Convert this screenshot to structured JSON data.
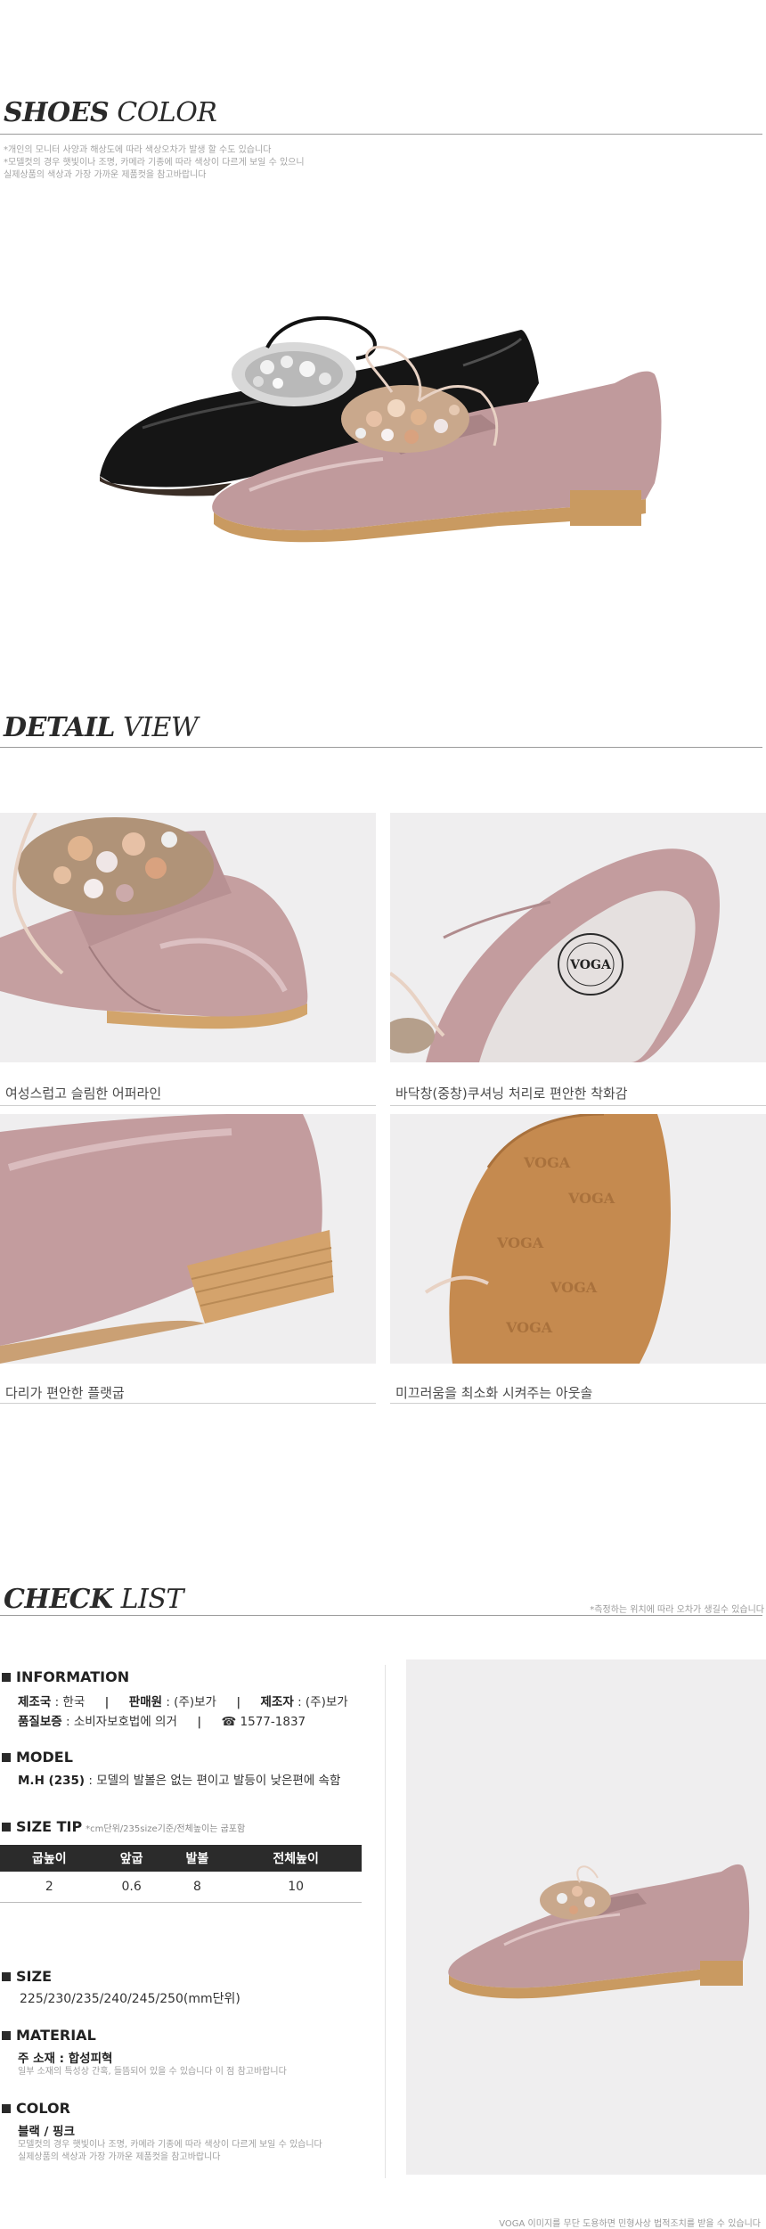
{
  "shoes_color": {
    "title_bold": "SHOES",
    "title_rest": "COLOR",
    "notes": [
      "*개인의 모니터 사양과 해상도에 따라 색상오차가 발생 할 수도 있습니다",
      "*모델컷의 경우 햇빛이나 조명, 카메라 기종에 따라 색상이 다르게 보일 수 있으니",
      "  실제상품의 색상과 가장 가까운 제품컷을 참고바랍니다"
    ]
  },
  "detail_view": {
    "title_bold": "DETAIL",
    "title_rest": "VIEW",
    "captions": [
      "여성스럽고 슬림한 어퍼라인",
      "바닥창(중창)쿠셔닝 처리로 편안한 착화감",
      "다리가 편안한 플랫굽",
      "미끄러움을 최소화 시켜주는 아웃솔"
    ],
    "insole_logo": "VOGA",
    "outsole_logo": "VOGA"
  },
  "check_list": {
    "title_bold": "CHECK",
    "title_rest": "LIST",
    "note": "*측정하는 위치에 따라 오차가 생길수 있습니다",
    "information": {
      "heading": "INFORMATION",
      "origin_label": "제조국",
      "origin": ": 한국",
      "seller_label": "판매원",
      "seller": ": (주)보가",
      "maker_label": "제조자",
      "maker": ": (주)보가",
      "warranty_label": "품질보증",
      "warranty": ": 소비자보호법에 의거",
      "phone": "☎ 1577-1837"
    },
    "model": {
      "heading": "MODEL",
      "label": "M.H (235)",
      "text": ": 모델의 발볼은 없는 편이고 발등이 낮은편에 속함"
    },
    "size_tip": {
      "heading": "SIZE TIP",
      "sub": "*cm단위/235size기준/전체높이는 굽포함",
      "headers": [
        "굽높이",
        "앞굽",
        "발볼",
        "전체높이"
      ],
      "values": [
        "2",
        "0.6",
        "8",
        "10"
      ]
    },
    "size": {
      "heading": "SIZE",
      "text": "225/230/235/240/245/250(mm단위)"
    },
    "material": {
      "heading": "MATERIAL",
      "label": "주 소재 : 합성피혁",
      "note": "일부 소재의 특성상 간혹, 들뜸되어 있을 수 있습니다 이 점 참고바랍니다"
    },
    "color": {
      "heading": "COLOR",
      "value": "블랙 / 핑크",
      "notes": [
        "모델컷의 경우 햇빛이나 조명, 카메라 기종에 따라 색상이 다르게 보일 수 있습니다",
        "실제상품의 색상과 가장 가까운 제품컷을 참고바랍니다"
      ]
    }
  },
  "footer": "VOGA 이미지를 무단 도용하면 민형사상 법적조치를 받을 수 있습니다",
  "colors": {
    "heading": "#2a2a2a",
    "rule": "#9a9a9a",
    "shoe_pink": "#c09a9c",
    "shoe_black": "#151515",
    "sole": "#c99a61",
    "photo_bg": "#efeeef"
  }
}
